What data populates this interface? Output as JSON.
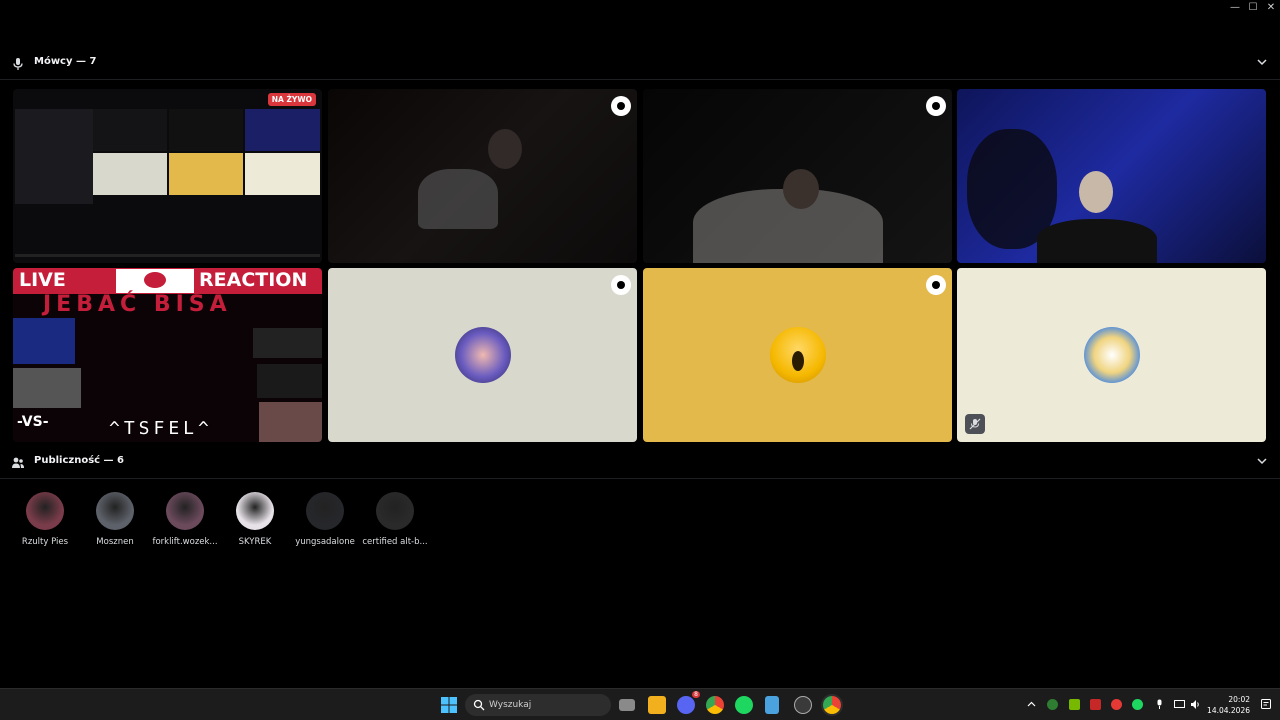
{
  "window": {
    "minimize_glyph": "—",
    "maximize_glyph": "☐",
    "close_glyph": "✕"
  },
  "speakers_section": {
    "label": "Mówcy — 7"
  },
  "live_badge": "NA ŻYWO",
  "screenshare_overlay": {
    "left": "LIVE",
    "right": "REACTION",
    "banner": "JEBAĆ BISA",
    "footer": "^TSFEL^",
    "vs": "-VS-"
  },
  "audience_section": {
    "label": "Publiczność — 6"
  },
  "audience": [
    {
      "name": "Rzulty Pies",
      "color": "#7a3c4a"
    },
    {
      "name": "Mosznen",
      "color": "#5d6169"
    },
    {
      "name": "forklift.wozek...",
      "color": "#6b4a5c"
    },
    {
      "name": "SKYREK",
      "color": "#e7e2e8"
    },
    {
      "name": "yungsadalone",
      "color": "#26272b"
    },
    {
      "name": "certified alt-b...",
      "color": "#2a2a2a"
    }
  ],
  "taskbar": {
    "search_placeholder": "Wyszukaj",
    "time": "20:02",
    "date": "14.04.2026",
    "discord_badge": "8"
  },
  "colors": {
    "tile_grey": "#d9d8cd",
    "tile_yellow": "#e3b94b",
    "tile_cream": "#eeead8",
    "live_red": "#da373c"
  }
}
